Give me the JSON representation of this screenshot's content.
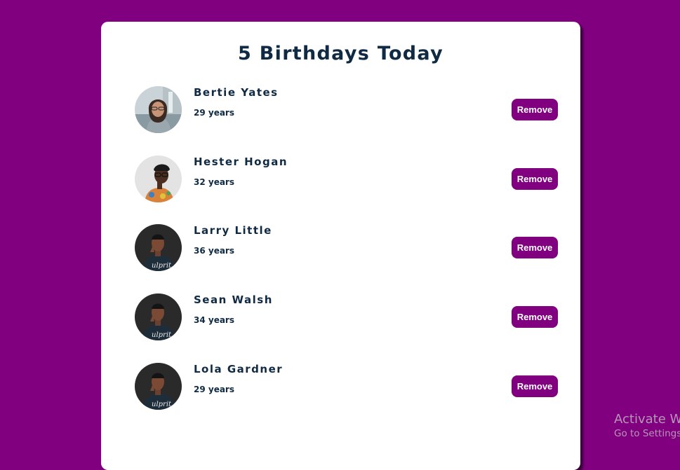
{
  "header": {
    "title": "5 Birthdays Today"
  },
  "people": [
    {
      "name": "Bertie Yates",
      "age": "29 years",
      "avatar": "woman-with-glasses-photo",
      "remove_label": "Remove"
    },
    {
      "name": "Hester Hogan",
      "age": "32 years",
      "avatar": "woman-floral-shirt-photo",
      "remove_label": "Remove"
    },
    {
      "name": "Larry Little",
      "age": "36 years",
      "avatar": "man-dark-shirt-photo",
      "remove_label": "Remove"
    },
    {
      "name": "Sean Walsh",
      "age": "34 years",
      "avatar": "man-dark-shirt-photo",
      "remove_label": "Remove"
    },
    {
      "name": "Lola Gardner",
      "age": "29 years",
      "avatar": "man-dark-shirt-photo",
      "remove_label": "Remove"
    }
  ],
  "watermark": {
    "title": "Activate W",
    "subtitle": "Go to Settings"
  },
  "colors": {
    "background": "#800080",
    "card": "#ffffff",
    "text": "#102a43",
    "button": "#800080",
    "button_text": "#ffffff"
  }
}
